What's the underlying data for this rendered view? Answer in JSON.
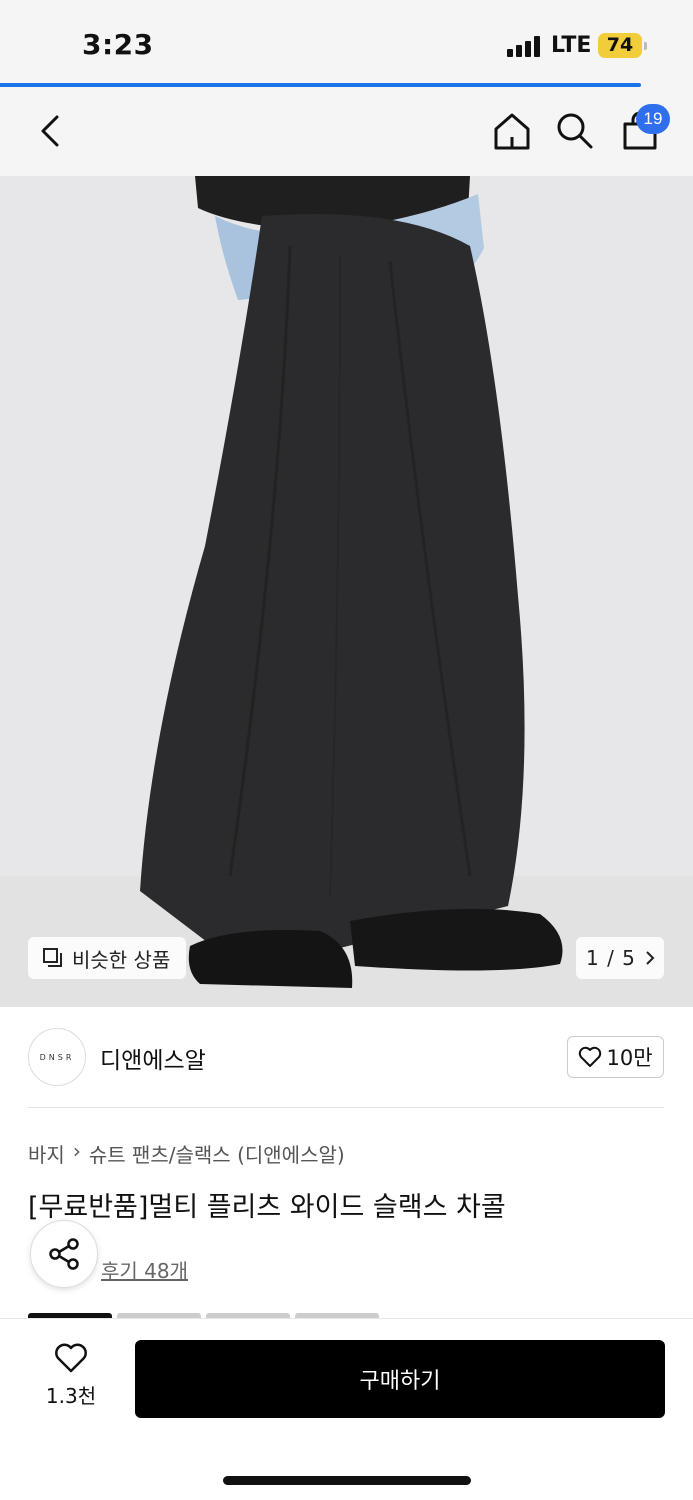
{
  "status_bar": {
    "time": "3:23",
    "network": "LTE",
    "battery": "74",
    "battery_color": "#f2cd3a",
    "page_load_progress": 0.925
  },
  "nav": {
    "back_icon": "chevron-left-icon",
    "home_icon": "home-icon",
    "search_icon": "search-icon",
    "cart_icon": "shopping-bag-icon",
    "cart_count": "19",
    "badge_color": "#2f6fed"
  },
  "gallery": {
    "similar_label": "비슷한 상품",
    "counter": "1 / 5",
    "counter_icon": "chevron-right-icon"
  },
  "brand": {
    "logo_text": "DNSR",
    "name": "디앤에스알",
    "like_count": "10만"
  },
  "product": {
    "breadcrumb": [
      "바지",
      "슈트 팬츠/슬랙스 (디앤에스알)"
    ],
    "title": "[무료반품]멀티 플리츠 와이드 슬랙스 차콜",
    "reviews": "후기 48개"
  },
  "bottom_bar": {
    "wish_count": "1.3천",
    "buy_label": "구매하기"
  }
}
